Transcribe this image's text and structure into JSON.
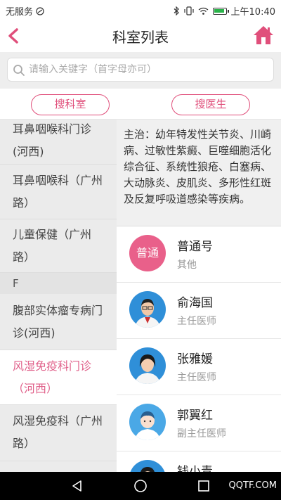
{
  "status_bar": {
    "carrier": "无服务",
    "time": "上午10:40",
    "battery_level": 0.9,
    "icons": [
      "no-signal-icon",
      "bluetooth-icon",
      "vibrate-icon",
      "wifi-icon",
      "battery-icon"
    ]
  },
  "header": {
    "title": "科室列表",
    "back_icon": "chevron-left-icon",
    "home_icon": "home-icon"
  },
  "search": {
    "placeholder": "请输入关键字（首字母亦可）"
  },
  "tabs": {
    "dept_label": "搜科室",
    "doctor_label": "搜医生"
  },
  "departments": [
    {
      "label": "耳鼻咽喉科门诊(河西)",
      "selected": false
    },
    {
      "label": "耳鼻咽喉科（广州路）",
      "selected": false
    },
    {
      "label": "儿童保健（广州路）",
      "selected": false
    },
    {
      "letter": "F"
    },
    {
      "label": "腹部实体瘤专病门诊(河西)",
      "selected": false
    },
    {
      "label": "风湿免疫科门诊（河西）",
      "selected": true
    },
    {
      "label": "风湿免疫科（广州路）",
      "selected": false
    }
  ],
  "dept_info": "主治：幼年特发性关节炎、川崎病、过敏性紫癜、巨噬细胞活化综合征、系统性狼疮、白塞病、大动脉炎、皮肌炎、多形性红斑及反复呼吸道感染等疾病。",
  "doctors": [
    {
      "name": "普通号",
      "title": "其他",
      "avatar_text": "普通",
      "avatar": "normal"
    },
    {
      "name": "俞海国",
      "title": "主任医师",
      "avatar": "male-doctor"
    },
    {
      "name": "张雅媛",
      "title": "主任医师",
      "avatar": "female-doctor"
    },
    {
      "name": "郭翼红",
      "title": "副主任医师",
      "avatar": "placeholder"
    },
    {
      "name": "钱小青",
      "title": "",
      "avatar": "female-doctor"
    }
  ],
  "watermark": "QQTF.COM",
  "colors": {
    "accent": "#e04f7b",
    "selected_text": "#e0608a"
  }
}
